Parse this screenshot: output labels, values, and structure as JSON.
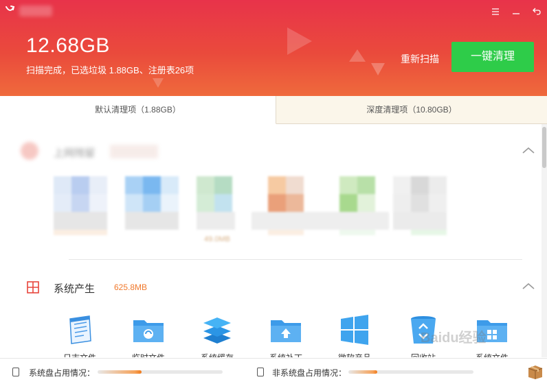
{
  "header": {
    "total_size": "12.68GB",
    "scan_summary": "扫描完成，已选垃圾 1.88GB、注册表26项",
    "rescan_label": "重新扫描",
    "clean_button_label": "一键清理",
    "accent_color": "#e8334a",
    "clean_button_color": "#2ecc49"
  },
  "window_controls": {
    "menu_icon": "menu-icon",
    "minimize_icon": "minimize-icon",
    "back_icon": "back-icon"
  },
  "tabs": [
    {
      "label": "默认清理项（1.88GB）",
      "active": true
    },
    {
      "label": "深度清理项（10.80GB）",
      "active": false
    }
  ],
  "sections": {
    "system": {
      "title": "系统产生",
      "size": "625.8MB",
      "icon": "windows-icon",
      "size_color": "#f0782b",
      "items": [
        {
          "label": "日志文件",
          "icon": "notepad-icon"
        },
        {
          "label": "临时文件",
          "icon": "folder-icon"
        },
        {
          "label": "系统缓存",
          "icon": "layers-icon"
        },
        {
          "label": "系统补丁",
          "icon": "folder-upload-icon"
        },
        {
          "label": "微软产品",
          "icon": "windows-logo-icon"
        },
        {
          "label": "回收站",
          "icon": "recycle-bin-icon"
        },
        {
          "label": "系统文件",
          "icon": "folder-windows-icon"
        }
      ]
    },
    "blurred": {
      "title": "上网残留",
      "item_size": "49.0MB"
    }
  },
  "statusbar": {
    "system_disk_label": "系统盘占用情况：",
    "system_disk_usage": 0.35,
    "other_disk_label": "非系统盘占用情况：",
    "other_disk_usage": 0.23,
    "box_icon": "box-icon"
  },
  "watermark": "Baidu经验"
}
